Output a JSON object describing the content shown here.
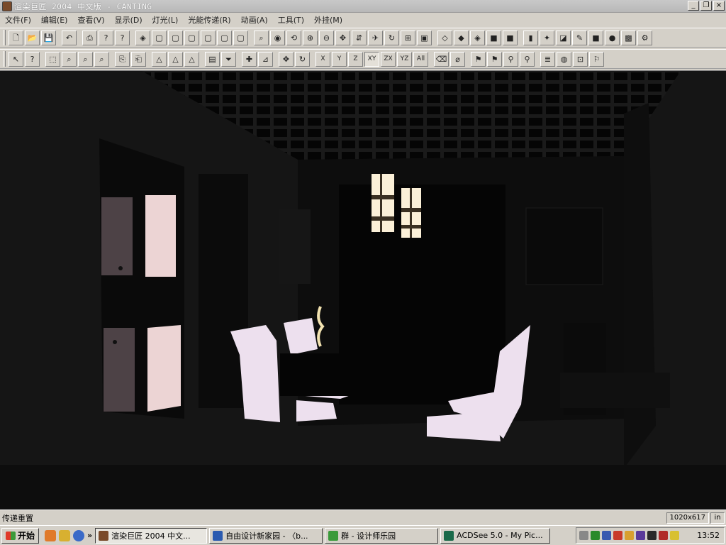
{
  "window": {
    "title": "渲染巨匠 2004 中文版 - CANTING",
    "minimize": "_",
    "restore": "❐",
    "close": "×"
  },
  "menu": [
    "文件(F)",
    "编辑(E)",
    "查看(V)",
    "显示(D)",
    "灯光(L)",
    "光能传递(R)",
    "动画(A)",
    "工具(T)",
    "外挂(M)"
  ],
  "toolbar1": [
    {
      "name": "new-icon",
      "glyph": "🗋"
    },
    {
      "name": "open-icon",
      "glyph": "📂"
    },
    {
      "name": "save-icon",
      "glyph": "💾"
    },
    {
      "name": "undo-icon",
      "glyph": "↶"
    },
    {
      "name": "print-icon",
      "glyph": "⎙"
    },
    {
      "name": "help-icon",
      "glyph": "?"
    },
    {
      "name": "context-help-icon",
      "glyph": "?"
    },
    {
      "name": "render-icon",
      "glyph": "◈"
    },
    {
      "name": "cube-view-1-icon",
      "glyph": "▢"
    },
    {
      "name": "cube-view-2-icon",
      "glyph": "▢"
    },
    {
      "name": "cube-view-3-icon",
      "glyph": "▢"
    },
    {
      "name": "cube-view-4-icon",
      "glyph": "▢"
    },
    {
      "name": "cube-view-5-icon",
      "glyph": "▢"
    },
    {
      "name": "cube-view-6-icon",
      "glyph": "▢"
    },
    {
      "name": "camera-zoom-icon",
      "glyph": "⌕"
    },
    {
      "name": "eye-icon",
      "glyph": "◉"
    },
    {
      "name": "orbit-icon",
      "glyph": "⟲"
    },
    {
      "name": "zoom-in-icon",
      "glyph": "⊕"
    },
    {
      "name": "zoom-out-icon",
      "glyph": "⊖"
    },
    {
      "name": "pan-icon",
      "glyph": "✥"
    },
    {
      "name": "walk-icon",
      "glyph": "⇵"
    },
    {
      "name": "fly-icon",
      "glyph": "✈"
    },
    {
      "name": "rotate-icon",
      "glyph": "↻"
    },
    {
      "name": "zoom-window-icon",
      "glyph": "⊞"
    },
    {
      "name": "snapshot-icon",
      "glyph": "▣"
    },
    {
      "name": "shade-wire-icon",
      "glyph": "◇"
    },
    {
      "name": "shade-flat-icon",
      "glyph": "◆"
    },
    {
      "name": "shade-smooth-icon",
      "glyph": "◈"
    },
    {
      "name": "shade-green-icon",
      "glyph": "■"
    },
    {
      "name": "shade-solid-icon",
      "glyph": "■"
    },
    {
      "name": "door-icon",
      "glyph": "▮"
    },
    {
      "name": "light-icon",
      "glyph": "✦"
    },
    {
      "name": "material-icon",
      "glyph": "◪"
    },
    {
      "name": "brush-icon",
      "glyph": "✎"
    },
    {
      "name": "yellow-swatch-icon",
      "glyph": "■"
    },
    {
      "name": "sphere-icon",
      "glyph": "●"
    },
    {
      "name": "texture-icon",
      "glyph": "▩"
    },
    {
      "name": "render-settings-icon",
      "glyph": "⚙"
    }
  ],
  "toolbar2": [
    {
      "name": "select-icon",
      "glyph": "↖"
    },
    {
      "name": "select-help-icon",
      "glyph": "?"
    },
    {
      "name": "select-window-icon",
      "glyph": "⬚"
    },
    {
      "name": "select-zoom-icon",
      "glyph": "⌕"
    },
    {
      "name": "select-disabled-1-icon",
      "glyph": "⌕"
    },
    {
      "name": "select-disabled-2-icon",
      "glyph": "⌕"
    },
    {
      "name": "copy-icon",
      "glyph": "⎘"
    },
    {
      "name": "paste-icon",
      "glyph": "⎗"
    },
    {
      "name": "triangle-1-icon",
      "glyph": "△"
    },
    {
      "name": "triangle-2-icon",
      "glyph": "△"
    },
    {
      "name": "triangle-3-icon",
      "glyph": "△"
    },
    {
      "name": "layer-icon",
      "glyph": "▤"
    },
    {
      "name": "filter-icon",
      "glyph": "⏷"
    },
    {
      "name": "add-point-icon",
      "glyph": "✚"
    },
    {
      "name": "measure-icon",
      "glyph": "⊿"
    },
    {
      "name": "move-icon",
      "glyph": "✥"
    },
    {
      "name": "rotate-obj-icon",
      "glyph": "↻"
    },
    {
      "name": "axis-x-icon",
      "glyph": "X"
    },
    {
      "name": "axis-y-icon",
      "glyph": "Y"
    },
    {
      "name": "axis-z-icon",
      "glyph": "Z"
    },
    {
      "name": "plane-xy-icon",
      "glyph": "XY"
    },
    {
      "name": "plane-zx-icon",
      "glyph": "ZX"
    },
    {
      "name": "plane-yz-icon",
      "glyph": "YZ"
    },
    {
      "name": "plane-all-icon",
      "glyph": "All"
    },
    {
      "name": "undo-transform-icon",
      "glyph": "⌫"
    },
    {
      "name": "reset-icon",
      "glyph": "⌀"
    },
    {
      "name": "run-1-icon",
      "glyph": "⚑"
    },
    {
      "name": "run-2-icon",
      "glyph": "⚑"
    },
    {
      "name": "walker-icon",
      "glyph": "⚲"
    },
    {
      "name": "pin-icon",
      "glyph": "⚲"
    },
    {
      "name": "layers-stack-icon",
      "glyph": "≣"
    },
    {
      "name": "globe-icon",
      "glyph": "◍"
    },
    {
      "name": "lock-icon",
      "glyph": "⊡"
    },
    {
      "name": "paint-icon",
      "glyph": "⚐"
    }
  ],
  "status": {
    "text": "传递重置",
    "resolution": "1020x617",
    "unit": "in"
  },
  "taskbar": {
    "start": "开始",
    "chevron": "»",
    "tasks": [
      {
        "label": "渲染巨匠 2004 中文...",
        "active": true,
        "color": "#7a4a2a"
      },
      {
        "label": "自由设计新家园 - 〈b...",
        "active": false,
        "color": "#2a5ab0"
      },
      {
        "label": "群 - 设计师乐园",
        "active": false,
        "color": "#3a9a3a"
      },
      {
        "label": "ACDSee 5.0 - My Pic...",
        "active": false,
        "color": "#1a6a4a"
      }
    ],
    "clock": "13:52"
  },
  "colors": {
    "viewport_bg": "#121212",
    "chair_fabric": "#ede0ee",
    "cabinet_door_light": "#ecd4d4",
    "cabinet_door_dark": "#4d4246",
    "lamp_glow": "#fbf0d8"
  }
}
